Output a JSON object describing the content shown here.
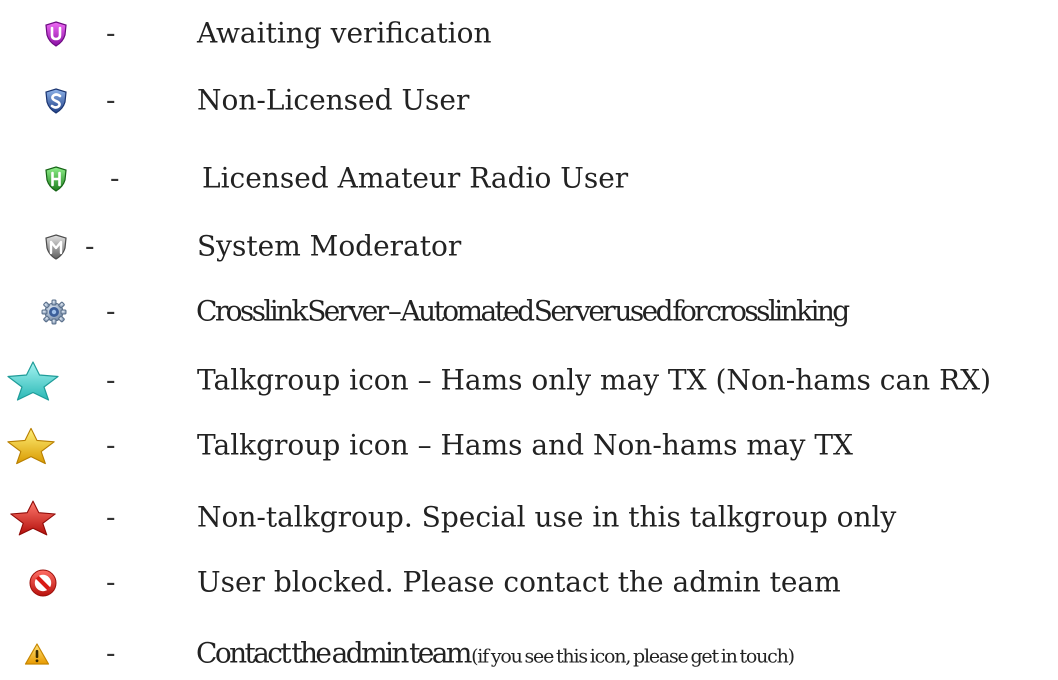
{
  "legend": {
    "separator": "-",
    "items": [
      {
        "icon": "shield-u-icon",
        "color": "#b81fd0",
        "label": "Awaiting verification"
      },
      {
        "icon": "shield-s-icon",
        "color": "#2f5aa6",
        "label": "Non-Licensed User"
      },
      {
        "icon": "shield-h-icon",
        "color": "#2fa52f",
        "label": "Licensed Amateur Radio User"
      },
      {
        "icon": "shield-m-icon",
        "color": "#8c8c8c",
        "label": "System Moderator"
      },
      {
        "icon": "gear-icon",
        "color": "#5b7fb0",
        "label": "Crosslink Server – Automated Server used for crosslinking"
      },
      {
        "icon": "star-icon",
        "color": "#3fd2cf",
        "label": "Talkgroup icon – Hams only may TX (Non-hams can RX)"
      },
      {
        "icon": "star-icon",
        "color": "#f0c419",
        "label": "Talkgroup icon – Hams and Non-hams may TX"
      },
      {
        "icon": "star-icon",
        "color": "#d9221e",
        "label": "Non-talkgroup. Special use in this talkgroup only"
      },
      {
        "icon": "blocked-icon",
        "color": "#e0201a",
        "label": "User blocked. Please contact the admin team"
      },
      {
        "icon": "warning-icon",
        "color": "#f5b800",
        "label": "Contact the admin team",
        "note": "(if you see this icon, please get in touch)"
      }
    ]
  }
}
